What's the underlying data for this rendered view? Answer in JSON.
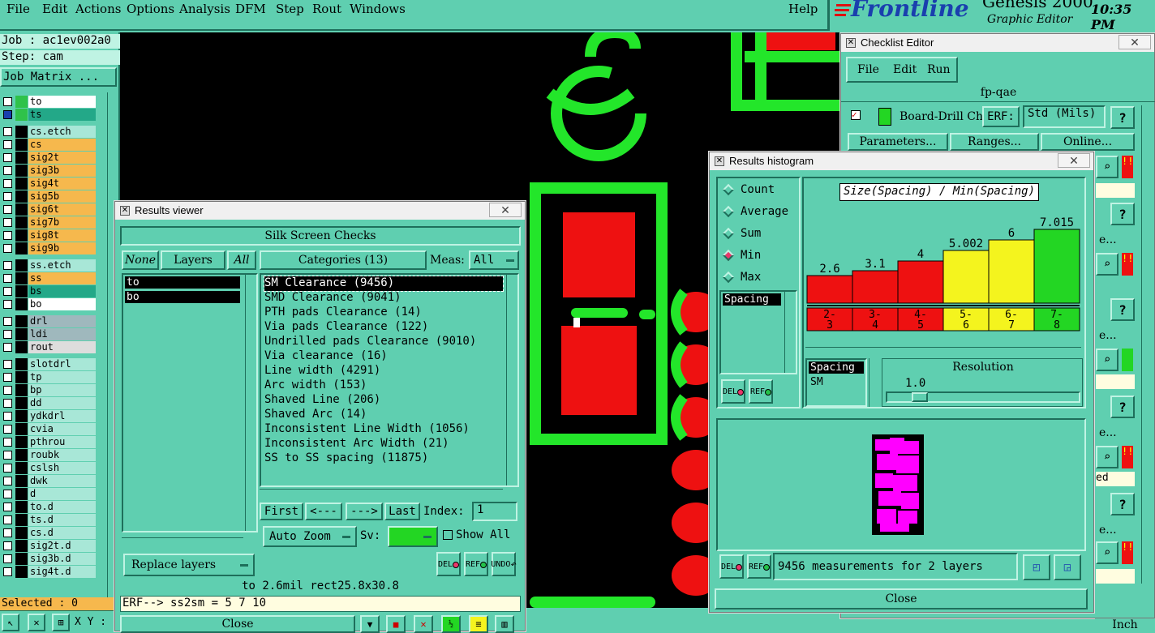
{
  "menubar": {
    "items": [
      "File",
      "Edit",
      "Actions",
      "Options",
      "Analysis",
      "DFM",
      "Step",
      "Rout",
      "Windows"
    ],
    "help": "Help"
  },
  "brand": {
    "logo": "Frontline",
    "product": "Genesis 2000",
    "subtitle": "Graphic Editor",
    "time": "10:35 PM"
  },
  "left": {
    "job": "Job : ac1ev002a0",
    "step": "Step: cam",
    "job_matrix": "Job Matrix ...",
    "layers": [
      {
        "name": "to",
        "color": "#2fc24a",
        "bg": "#ffffff"
      },
      {
        "name": "ts",
        "color": "#2fc24a",
        "bg": "#23a888"
      },
      {
        "name": "cs.etch",
        "color": "#000000",
        "bg": "#a8e7d7"
      },
      {
        "name": "cs",
        "color": "#000000",
        "bg": "#f6b84d"
      },
      {
        "name": "sig2t",
        "color": "#000000",
        "bg": "#f6b84d"
      },
      {
        "name": "sig3b",
        "color": "#000000",
        "bg": "#f6b84d"
      },
      {
        "name": "sig4t",
        "color": "#000000",
        "bg": "#f6b84d"
      },
      {
        "name": "sig5b",
        "color": "#000000",
        "bg": "#f6b84d"
      },
      {
        "name": "sig6t",
        "color": "#000000",
        "bg": "#f6b84d"
      },
      {
        "name": "sig7b",
        "color": "#000000",
        "bg": "#f6b84d"
      },
      {
        "name": "sig8t",
        "color": "#000000",
        "bg": "#f6b84d"
      },
      {
        "name": "sig9b",
        "color": "#000000",
        "bg": "#f6b84d"
      },
      {
        "name": "ss.etch",
        "color": "#000000",
        "bg": "#a8e7d7"
      },
      {
        "name": "ss",
        "color": "#000000",
        "bg": "#f6b84d"
      },
      {
        "name": "bs",
        "color": "#000000",
        "bg": "#23a888"
      },
      {
        "name": "bo",
        "color": "#000000",
        "bg": "#ffffff"
      },
      {
        "name": "drl",
        "color": "#000000",
        "bg": "#9fb8bd"
      },
      {
        "name": "ldi",
        "color": "#000000",
        "bg": "#9fb8bd"
      },
      {
        "name": "rout",
        "color": "#000000",
        "bg": "#dddddd"
      },
      {
        "name": "slotdrl",
        "color": "#000000",
        "bg": "#a8e7d7"
      },
      {
        "name": "tp",
        "color": "#000000",
        "bg": "#a8e7d7"
      },
      {
        "name": "bp",
        "color": "#000000",
        "bg": "#a8e7d7"
      },
      {
        "name": "dd",
        "color": "#000000",
        "bg": "#a8e7d7"
      },
      {
        "name": "ydkdrl",
        "color": "#000000",
        "bg": "#a8e7d7"
      },
      {
        "name": "cvia",
        "color": "#000000",
        "bg": "#a8e7d7"
      },
      {
        "name": "pthrou",
        "color": "#000000",
        "bg": "#a8e7d7"
      },
      {
        "name": "roubk",
        "color": "#000000",
        "bg": "#a8e7d7"
      },
      {
        "name": "cslsh",
        "color": "#000000",
        "bg": "#a8e7d7"
      },
      {
        "name": "dwk",
        "color": "#000000",
        "bg": "#a8e7d7"
      },
      {
        "name": "d",
        "color": "#000000",
        "bg": "#a8e7d7"
      },
      {
        "name": "to.d",
        "color": "#000000",
        "bg": "#a8e7d7"
      },
      {
        "name": "ts.d",
        "color": "#000000",
        "bg": "#a8e7d7"
      },
      {
        "name": "cs.d",
        "color": "#000000",
        "bg": "#a8e7d7"
      },
      {
        "name": "sig2t.d",
        "color": "#000000",
        "bg": "#a8e7d7"
      },
      {
        "name": "sig3b.d",
        "color": "#000000",
        "bg": "#a8e7d7"
      },
      {
        "name": "sig4t.d",
        "color": "#000000",
        "bg": "#a8e7d7"
      }
    ],
    "selected": "Selected : 0",
    "xy": "X Y :"
  },
  "results_viewer": {
    "title": "Results viewer",
    "header": "Silk Screen Checks",
    "none_btn": "None",
    "layers_btn": "Layers",
    "all_btn": "All",
    "layer_list": [
      "to",
      "bo"
    ],
    "categories_btn": "Categories (13)",
    "meas_label": "Meas:",
    "meas_value": "All",
    "categories": [
      "SM Clearance (9456)",
      "SMD Clearance (9041)",
      "PTH pads Clearance (14)",
      "Via pads Clearance (122)",
      "Undrilled pads Clearance (9010)",
      "Via clearance (16)",
      "Line width (4291)",
      "Arc width (153)",
      "Shaved Line (206)",
      "Shaved Arc (14)",
      "Inconsistent Line Width (1056)",
      "Inconsistent Arc Width (21)",
      "SS to SS spacing (11875)"
    ],
    "first": "First",
    "prev": "<---",
    "next": "--->",
    "last": "Last",
    "index_label": "Index:",
    "index_value": "1",
    "auto_zoom": "Auto Zoom",
    "sv_label": "Sv:",
    "show_all": "Show All",
    "replace_layers": "Replace layers",
    "del": "DEL",
    "ref": "REF",
    "undo": "UNDO",
    "info": "to 2.6mil  rect25.8x30.8",
    "erf": "ERF--> ss2sm = 5 7 10",
    "close": "Close"
  },
  "checklist": {
    "title": "Checklist Editor",
    "menu": [
      "File",
      "Edit",
      "Run"
    ],
    "name": "fp-qae",
    "item": "Board-Drill Che",
    "erf_label": "ERF:",
    "erf_value": "Std (Mils)",
    "parameters": "Parameters...",
    "ranges": "Ranges...",
    "online": "Online...",
    "side_texts": [
      "e...",
      "e...",
      "e...",
      "ed",
      "e..."
    ]
  },
  "histogram": {
    "title": "Results histogram",
    "modes": [
      "Count",
      "Average",
      "Sum",
      "Min",
      "Max"
    ],
    "selected_mode": "Min",
    "type_list": [
      "Spacing"
    ],
    "chart_title": "Size(Spacing) / Min(Spacing)",
    "sub_list": [
      "Spacing",
      "SM"
    ],
    "resolution_label": "Resolution",
    "resolution_value": "1.0",
    "measurements": "9456 measurements for 2 layers",
    "close": "Close",
    "del": "DEL",
    "ref": "REF"
  },
  "chart_data": {
    "type": "bar",
    "title": "Size(Spacing) / Min(Spacing)",
    "categories": [
      "2-3",
      "3-4",
      "4-5",
      "5-6",
      "6-7",
      "7-8"
    ],
    "values": [
      2.6,
      3.1,
      4,
      5.002,
      6,
      7.015
    ],
    "value_labels": [
      "2.6",
      "3.1",
      "4",
      "5.002",
      "6",
      "7.015"
    ],
    "colors": [
      "#ee1111",
      "#ee1111",
      "#ee1111",
      "#f4f41e",
      "#f4f41e",
      "#23d623"
    ],
    "bin_labels_top": [
      "2-",
      "3-",
      "4-",
      "5-",
      "6-",
      "7-"
    ],
    "bin_labels_bottom": [
      "3",
      "4",
      "5",
      "6",
      "7",
      "8"
    ],
    "ylim": [
      0,
      8
    ]
  },
  "statusbar": {
    "unit": "Inch"
  }
}
